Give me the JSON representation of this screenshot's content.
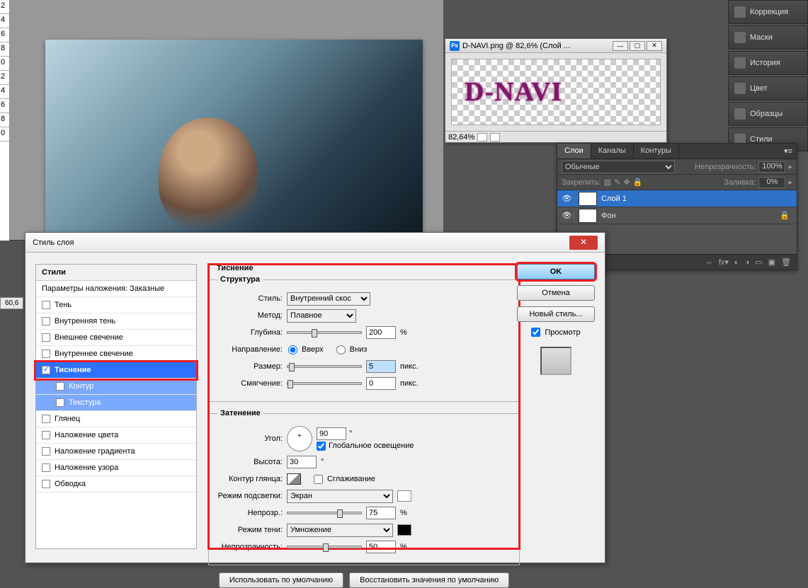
{
  "ruler_marks": [
    "2",
    "4",
    "6",
    "8",
    "0",
    "2",
    "4",
    "6",
    "8",
    "0"
  ],
  "zoom_label": "60,6",
  "right_panels": [
    "Коррекция",
    "Маски",
    "История",
    "Цвет",
    "Образцы",
    "Стили"
  ],
  "floating_doc": {
    "title": "D-NAVI.png @ 82,6% (Слой ...",
    "logo_text": "D-NAVI",
    "zoom": "82,64%"
  },
  "layers_panel": {
    "tabs": [
      "Слои",
      "Каналы",
      "Контуры"
    ],
    "blend_mode": "Обычные",
    "opacity_label": "Непрозрачность:",
    "opacity_value": "100%",
    "lock_label": "Закрепить:",
    "fill_label": "Заливка:",
    "fill_value": "0%",
    "layers": [
      {
        "name": "Слой 1",
        "selected": true
      },
      {
        "name": "Фон",
        "locked": true
      }
    ]
  },
  "dialog": {
    "title": "Стиль слоя",
    "styles_header": "Стили",
    "blending_options": "Параметры наложения: Заказные",
    "style_rows": [
      {
        "label": "Тень",
        "checked": false
      },
      {
        "label": "Внутренняя тень",
        "checked": false
      },
      {
        "label": "Внешнее свечение",
        "checked": false
      },
      {
        "label": "Внутреннее свечение",
        "checked": false
      },
      {
        "label": "Тиснение",
        "checked": true,
        "selected": true
      },
      {
        "label": "Контур",
        "indent": true,
        "checked": false,
        "sub": true
      },
      {
        "label": "Текстура",
        "indent": true,
        "checked": false,
        "sub": true
      },
      {
        "label": "Глянец",
        "checked": false
      },
      {
        "label": "Наложение цвета",
        "checked": false
      },
      {
        "label": "Наложение градиента",
        "checked": false
      },
      {
        "label": "Наложение узора",
        "checked": false
      },
      {
        "label": "Обводка",
        "checked": false
      }
    ],
    "bevel": {
      "group": "Тиснение",
      "structure": "Структура",
      "style_label": "Стиль:",
      "style_value": "Внутренний скос",
      "technique_label": "Метод:",
      "technique_value": "Плавное",
      "depth_label": "Глубина:",
      "depth_value": "200",
      "depth_unit": "%",
      "direction_label": "Направление:",
      "direction_up": "Вверх",
      "direction_down": "Вниз",
      "size_label": "Размер:",
      "size_value": "5",
      "size_unit": "пикс.",
      "soften_label": "Смягчение:",
      "soften_value": "0",
      "soften_unit": "пикс."
    },
    "shading": {
      "group": "Затенение",
      "angle_label": "Угол:",
      "angle_value": "90",
      "degree": "°",
      "global_light": "Глобальное освещение",
      "altitude_label": "Высота:",
      "altitude_value": "30",
      "gloss_contour_label": "Контур глянца:",
      "antialias": "Сглаживание",
      "highlight_mode_label": "Режим подсветки:",
      "highlight_mode_value": "Экран",
      "highlight_opacity_label": "Непрозр.:",
      "highlight_opacity_value": "75",
      "shadow_mode_label": "Режим тени:",
      "shadow_mode_value": "Умножение",
      "shadow_opacity_label": "Непрозрачность:",
      "shadow_opacity_value": "50",
      "percent": "%"
    },
    "defaults_btn": "Использовать по умолчанию",
    "reset_btn": "Восстановить значения по умолчанию",
    "ok": "OK",
    "cancel": "Отмена",
    "new_style": "Новый стиль...",
    "preview": "Просмотр"
  }
}
